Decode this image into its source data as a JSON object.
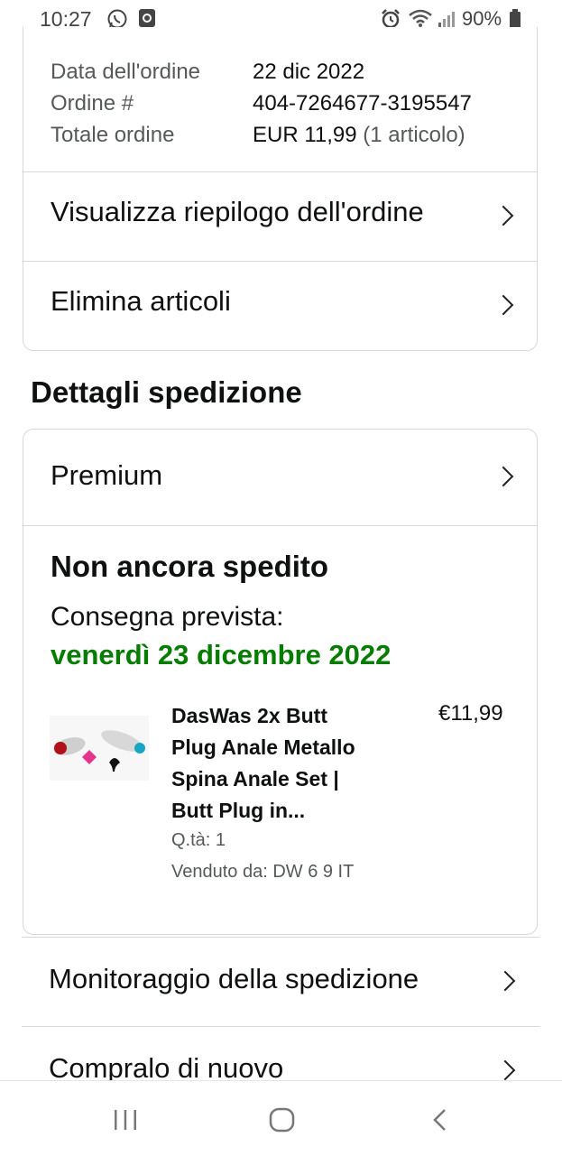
{
  "status_bar": {
    "time": "10:27",
    "battery": "90%",
    "icons": [
      "whatsapp-icon",
      "app-notification-icon",
      "alarm-icon",
      "wifi-icon",
      "signal-icon",
      "battery-icon"
    ]
  },
  "order_info": {
    "date_label": "Data dell'ordine",
    "date_value": "22 dic 2022",
    "number_label": "Ordine #",
    "number_value": "404-7264677-3195547",
    "total_label": "Totale ordine",
    "total_value": "EUR 11,99",
    "total_items": "(1 articolo)"
  },
  "actions": {
    "view_summary": "Visualizza riepilogo dell'ordine",
    "delete_items": "Elimina articoli"
  },
  "shipping": {
    "section_title": "Dettagli spedizione",
    "service": "Premium",
    "status": "Non ancora spedito",
    "delivery_label": "Consegna prevista:",
    "delivery_date": "venerdì 23 dicembre 2022",
    "item": {
      "title_lines": [
        "DasWas 2x Butt",
        "Plug Anale Metallo",
        "Spina Anale Set |",
        "Butt Plug in..."
      ],
      "price": "€11,99",
      "quantity": "Q.tà: 1",
      "seller": "Venduto da: DW 6 9 IT"
    }
  },
  "bottom_actions": {
    "tracking": "Monitoraggio della spedizione",
    "buy_again": "Compralo di nuovo"
  },
  "colors": {
    "delivery_green": "#067d00",
    "border": "#d5d9d9",
    "muted_text": "#565959"
  }
}
